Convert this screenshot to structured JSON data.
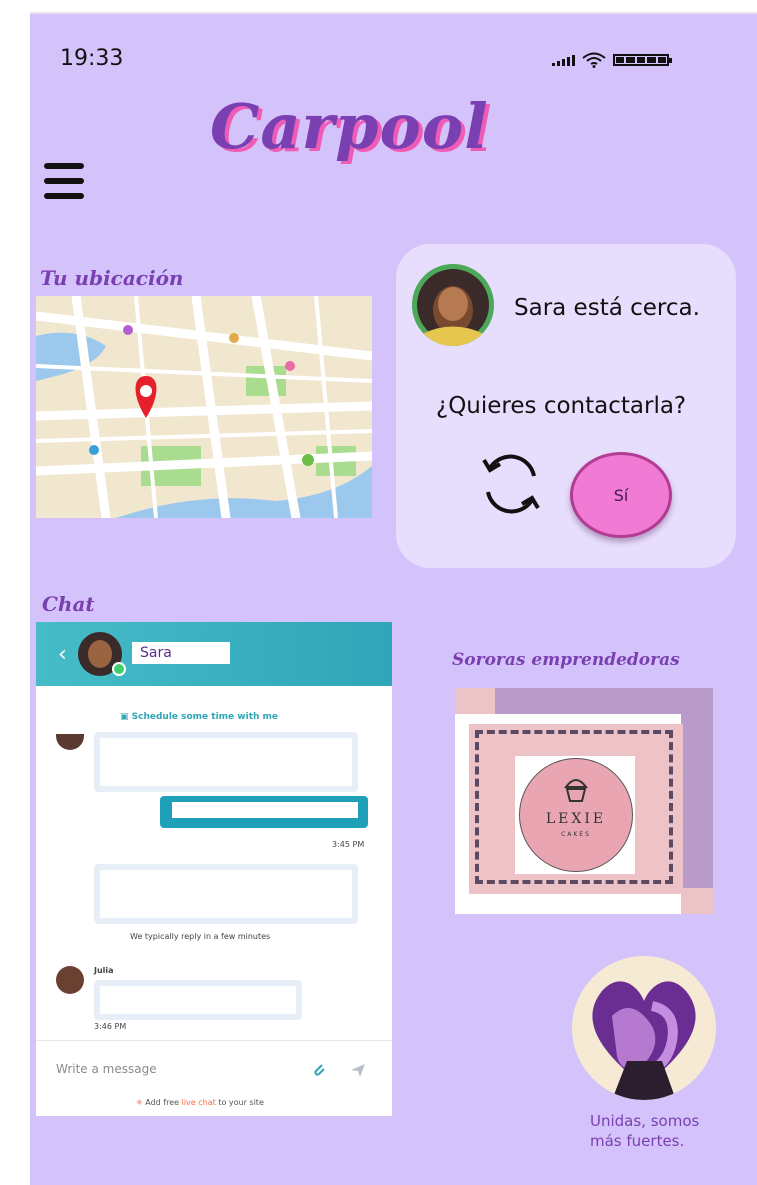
{
  "status_bar": {
    "time": "19:33"
  },
  "app": {
    "title": "Carpool"
  },
  "location": {
    "title": "Tu ubicación"
  },
  "nearby": {
    "message": "Sara está cerca.",
    "question": "¿Quieres contactarla?",
    "yes_button": "Sí"
  },
  "chat": {
    "section_title": "Chat",
    "contact_name": "Sara",
    "schedule_link": "Schedule some time with me",
    "timestamp_1": "3:45 PM",
    "reply_notice": "We typically reply in a few minutes",
    "sender_name": "Julia",
    "timestamp_2": "3:46 PM",
    "input_placeholder": "Write a message",
    "footer_prefix": "Add free",
    "footer_link": "live chat",
    "footer_suffix": "to your site"
  },
  "entrepreneurs": {
    "title": "Sororas emprendedoras",
    "brand_name": "LEXIE",
    "brand_sub": "CAKES"
  },
  "community": {
    "caption_line1": "Unidas, somos",
    "caption_line2": "más fuertes."
  },
  "colors": {
    "background": "#d4c3fb",
    "accent": "#7a3fb0",
    "pink": "#ee5cb6",
    "chat_header": "#46bcc8"
  }
}
